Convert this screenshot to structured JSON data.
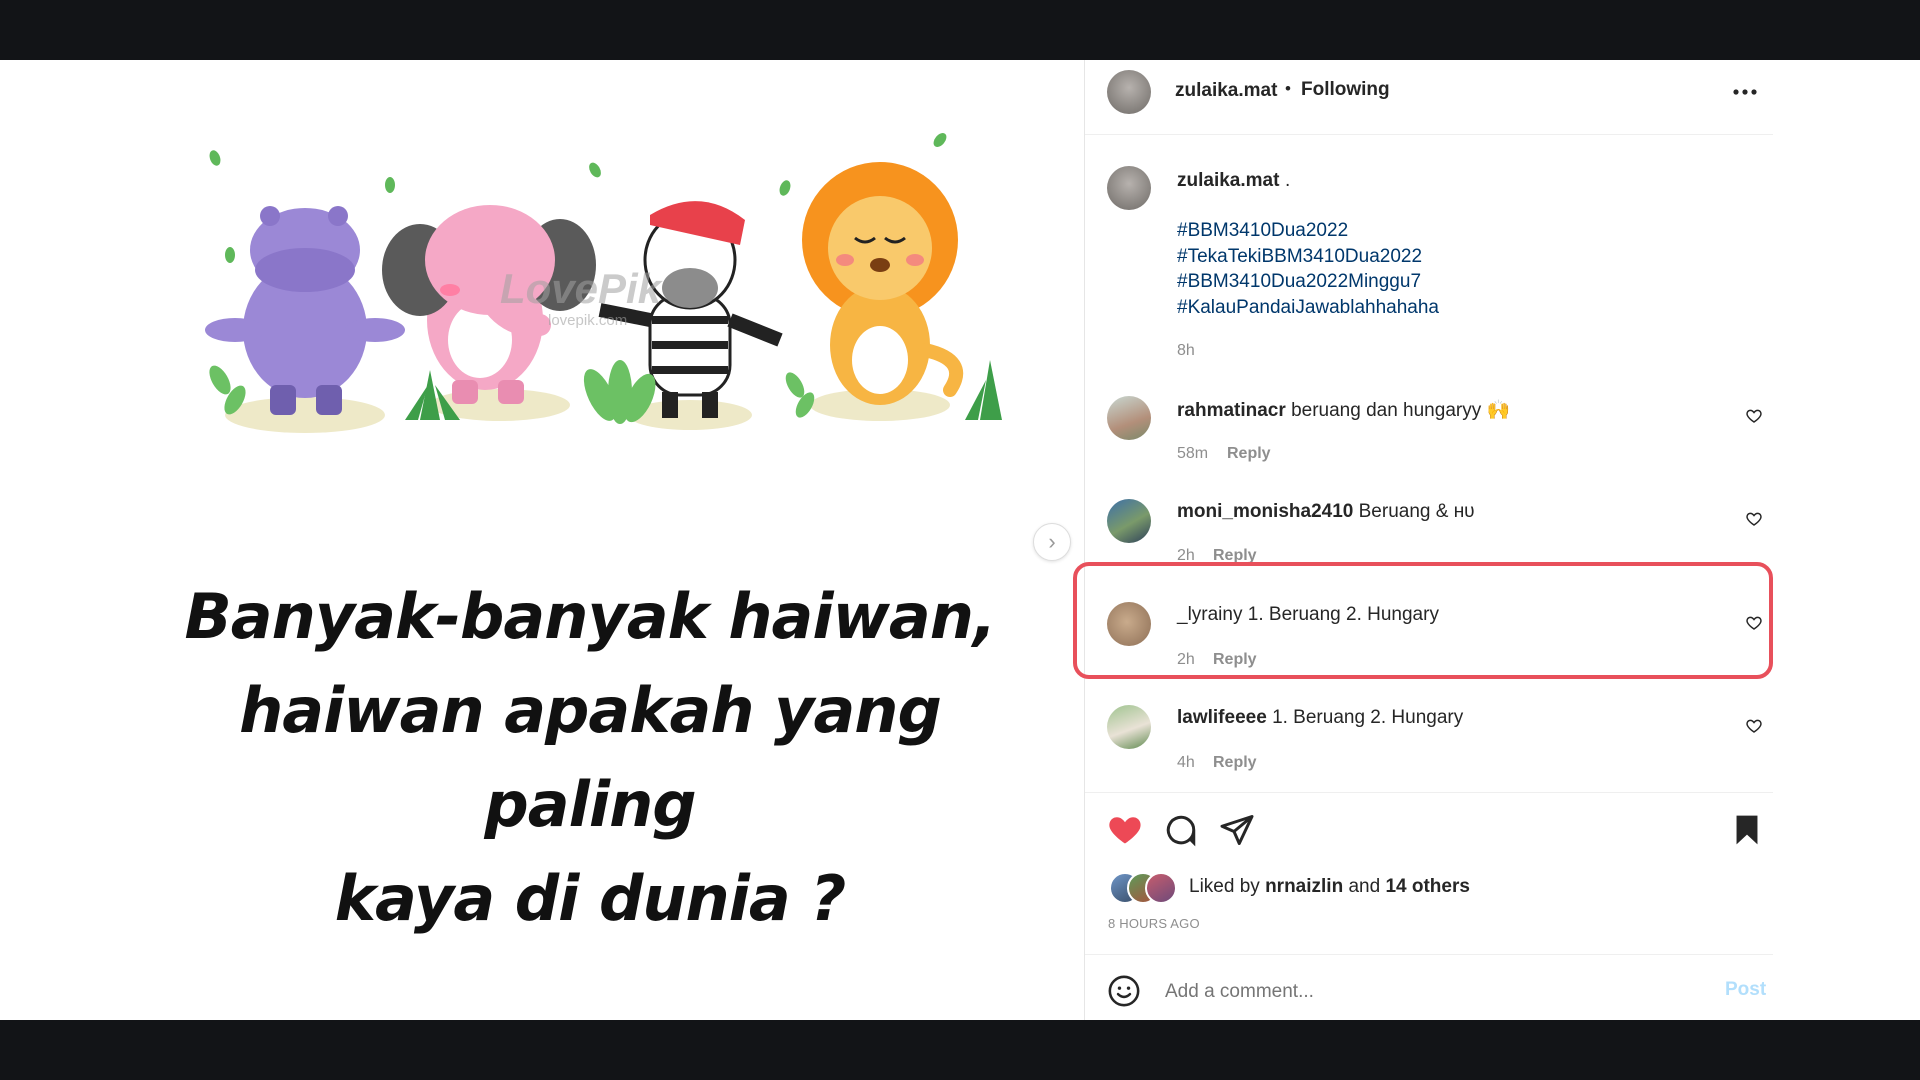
{
  "post": {
    "username": "zulaika.mat",
    "separator": "•",
    "follow_status": "Following",
    "more_icon": "more-horizontal-icon"
  },
  "media": {
    "watermark": "LovePik",
    "watermark_sub": "lovepik.com",
    "riddle_lines": [
      "Banyak-banyak haiwan,",
      "haiwan apakah yang paling",
      "kaya di dunia ?"
    ]
  },
  "caption": {
    "username": "zulaika.mat",
    "text": ".",
    "hashtags": [
      "#BBM3410Dua2022",
      "#TekaTekiBBM3410Dua2022",
      "#BBM3410Dua2022Minggu7",
      "#KalauPandaiJawablahhahaha"
    ],
    "time": "8h"
  },
  "comments": [
    {
      "username": "rahmatinacr",
      "text": "beruang dan hungaryy 🙌",
      "time": "58m",
      "reply": "Reply"
    },
    {
      "username": "moni_monisha2410",
      "text": "Beruang & ʜᴜ",
      "time": "2h",
      "reply": "Reply"
    },
    {
      "username": "_lyrainy",
      "text": "1. Beruang 2. Hungary",
      "time": "2h",
      "reply": "Reply"
    },
    {
      "username": "lawlifeeee",
      "text": "1. Beruang 2. Hungary",
      "time": "4h",
      "reply": "Reply"
    }
  ],
  "actions": {
    "liked_prefix": "Liked by",
    "liked_user": "nrnaizlin",
    "liked_and": "and",
    "liked_others": "14 others",
    "timestamp": "8 HOURS AGO"
  },
  "composer": {
    "placeholder": "Add a comment...",
    "post_label": "Post"
  },
  "colors": {
    "like_red": "#ed4956",
    "link_blue": "#00376b",
    "post_blue": "#b2dffc",
    "highlight": "#e8505b"
  }
}
